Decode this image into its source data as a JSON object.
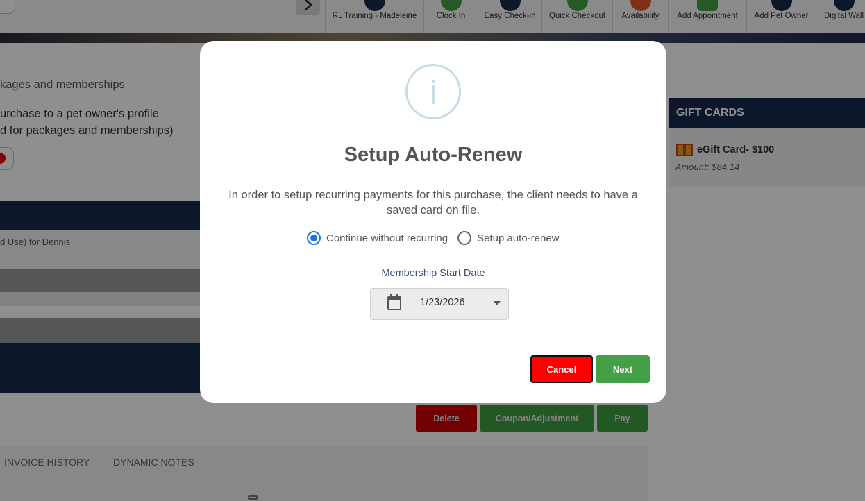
{
  "toolbar": {
    "items": [
      {
        "label": "RL Training - Madeleine",
        "icon": "shield-icon",
        "color": "#17294f"
      },
      {
        "label": "Clock In",
        "icon": "clock-icon",
        "color": "#43a047"
      },
      {
        "label": "Easy Check-in",
        "icon": "paw-icon",
        "color": "#17294f"
      },
      {
        "label": "Quick Checkout",
        "icon": "cart-icon",
        "color": "#43a047"
      },
      {
        "label": "Availability",
        "icon": "question-icon",
        "color": "#e5562a"
      },
      {
        "label": "Add Appointment",
        "icon": "calendar-add-icon",
        "color": "#43a047"
      },
      {
        "label": "Add Pet Owner",
        "icon": "person-add-icon",
        "color": "#17294f"
      },
      {
        "label": "Digital Wall",
        "icon": "monitor-icon",
        "color": "#17294f"
      }
    ]
  },
  "background": {
    "heading": "kages and memberships",
    "line1": "urchase to a pet owner's profile",
    "line2": "d for packages and memberships)",
    "row_text": "d Use) for Dennis",
    "gift_cards": {
      "title": "GIFT CARDS",
      "item_name": "eGift Card- $100",
      "item_amount": "Amount: $84.14"
    },
    "actions": {
      "delete": "Delete",
      "coupon": "Coupon/Adjustment",
      "pay": "Pay"
    },
    "tabs": [
      "INVOICE HISTORY",
      "DYNAMIC NOTES"
    ]
  },
  "modal": {
    "title": "Setup Auto-Renew",
    "message": "In order to setup recurring payments for this purchase, the client needs to have a saved card on file.",
    "options": [
      {
        "label": "Continue without recurring",
        "selected": true
      },
      {
        "label": "Setup auto-renew",
        "selected": false
      }
    ],
    "date_label": "Membership Start Date",
    "date_value": "1/23/2026",
    "cancel_label": "Cancel",
    "next_label": "Next"
  }
}
